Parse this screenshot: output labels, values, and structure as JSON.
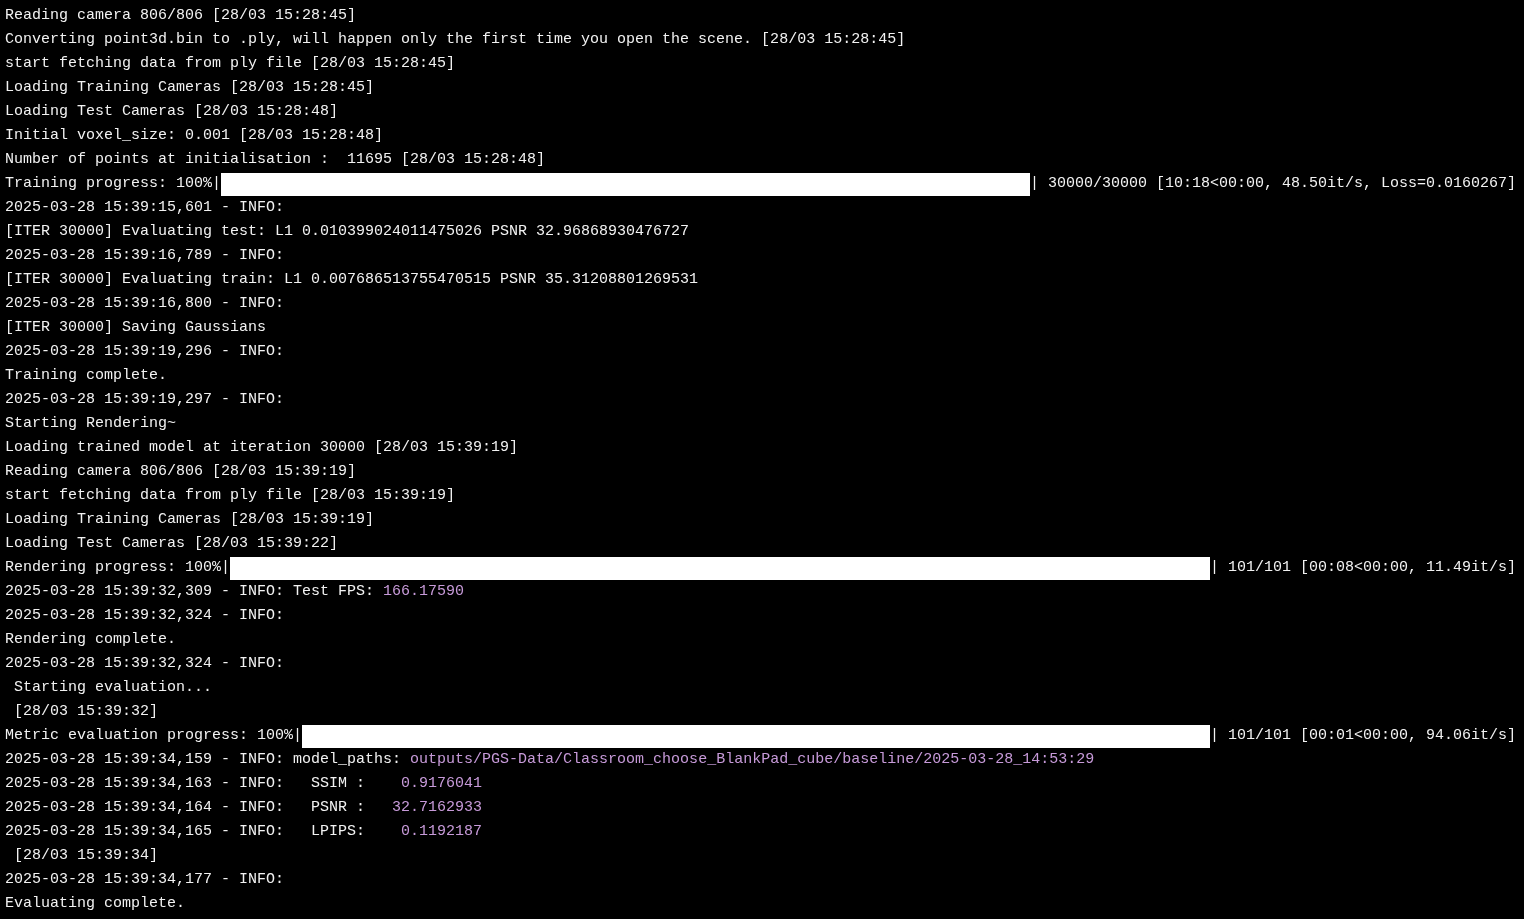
{
  "terminal": {
    "lines": [
      {
        "kind": "text",
        "text": "Reading camera 806/806 [28/03 15:28:45]"
      },
      {
        "kind": "text",
        "text": "Converting point3d.bin to .ply, will happen only the first time you open the scene. [28/03 15:28:45]"
      },
      {
        "kind": "text",
        "text": "start fetching data from ply file [28/03 15:28:45]"
      },
      {
        "kind": "text",
        "text": "Loading Training Cameras [28/03 15:28:45]"
      },
      {
        "kind": "text",
        "text": "Loading Test Cameras [28/03 15:28:48]"
      },
      {
        "kind": "text",
        "text": "Initial voxel_size: 0.001 [28/03 15:28:48]"
      },
      {
        "kind": "text",
        "text": "Number of points at initialisation :  11695 [28/03 15:28:48]"
      },
      {
        "kind": "progress",
        "label": "Training progress: 100%|",
        "level": 1,
        "tail": "| 30000/30000 [10:18<00:00, 48.50it/s, Loss=0.0160267]"
      },
      {
        "kind": "text",
        "text": "2025-03-28 15:39:15,601 - INFO:"
      },
      {
        "kind": "text",
        "text": "[ITER 30000] Evaluating test: L1 0.010399024011475026 PSNR 32.96868930476727"
      },
      {
        "kind": "text",
        "text": "2025-03-28 15:39:16,789 - INFO:"
      },
      {
        "kind": "text",
        "text": "[ITER 30000] Evaluating train: L1 0.007686513755470515 PSNR 35.31208801269531"
      },
      {
        "kind": "text",
        "text": "2025-03-28 15:39:16,800 - INFO:"
      },
      {
        "kind": "text",
        "text": "[ITER 30000] Saving Gaussians"
      },
      {
        "kind": "text",
        "text": "2025-03-28 15:39:19,296 - INFO:"
      },
      {
        "kind": "text",
        "text": "Training complete."
      },
      {
        "kind": "text",
        "text": "2025-03-28 15:39:19,297 - INFO:"
      },
      {
        "kind": "text",
        "text": "Starting Rendering~"
      },
      {
        "kind": "text",
        "text": "Loading trained model at iteration 30000 [28/03 15:39:19]"
      },
      {
        "kind": "text",
        "text": "Reading camera 806/806 [28/03 15:39:19]"
      },
      {
        "kind": "text",
        "text": "start fetching data from ply file [28/03 15:39:19]"
      },
      {
        "kind": "text",
        "text": "Loading Training Cameras [28/03 15:39:19]"
      },
      {
        "kind": "text",
        "text": "Loading Test Cameras [28/03 15:39:22]"
      },
      {
        "kind": "progress",
        "label": "Rendering progress: 100%|",
        "level": 1,
        "tail": "| 101/101 [00:08<00:00, 11.49it/s]"
      },
      {
        "kind": "value",
        "text": "2025-03-28 15:39:32,309 - INFO: Test FPS: ",
        "value": "166.17590"
      },
      {
        "kind": "text",
        "text": "2025-03-28 15:39:32,324 - INFO:"
      },
      {
        "kind": "text",
        "text": "Rendering complete."
      },
      {
        "kind": "text",
        "text": "2025-03-28 15:39:32,324 - INFO:"
      },
      {
        "kind": "text",
        "text": " Starting evaluation..."
      },
      {
        "kind": "text",
        "text": " [28/03 15:39:32]"
      },
      {
        "kind": "progress",
        "label": "Metric evaluation progress: 100%|",
        "level": 1,
        "tail": "| 101/101 [00:01<00:00, 94.06it/s]"
      },
      {
        "kind": "value",
        "text": "2025-03-28 15:39:34,159 - INFO: model_paths: ",
        "value": "outputs/PGS-Data/Classroom_choose_BlankPad_cube/baseline/2025-03-28_14:53:29"
      },
      {
        "kind": "value",
        "text": "2025-03-28 15:39:34,163 - INFO:   SSIM :    ",
        "value": "0.9176041"
      },
      {
        "kind": "value",
        "text": "2025-03-28 15:39:34,164 - INFO:   PSNR :   ",
        "value": "32.7162933"
      },
      {
        "kind": "value",
        "text": "2025-03-28 15:39:34,165 - INFO:   LPIPS:    ",
        "value": "0.1192187"
      },
      {
        "kind": "text",
        "text": " [28/03 15:39:34]"
      },
      {
        "kind": "text",
        "text": "2025-03-28 15:39:34,177 - INFO:"
      },
      {
        "kind": "text",
        "text": "Evaluating complete."
      }
    ]
  }
}
